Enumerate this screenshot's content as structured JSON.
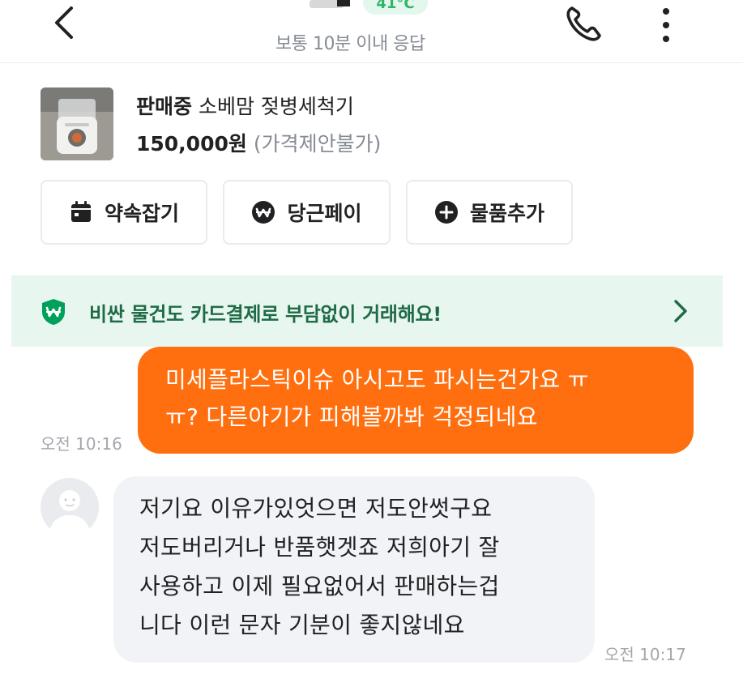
{
  "header": {
    "temperature": "41°C",
    "response_status": "보통 10분 이내 응답",
    "icons": [
      "back-arrow-icon",
      "phone-icon",
      "more-vertical-icon"
    ]
  },
  "product": {
    "status": "판매중",
    "title": "소베맘 젖병세척기",
    "price": "150,000원",
    "price_note": "(가격제안불가)"
  },
  "actions": [
    {
      "label": "약속잡기",
      "icon": "calendar-icon"
    },
    {
      "label": "당근페이",
      "icon": "won-pay-icon"
    },
    {
      "label": "물품추가",
      "icon": "plus-circle-icon"
    }
  ],
  "banner": {
    "text": "비싼 물건도 카드결제로 부담없이 거래해요!",
    "icon": "shield-won-icon"
  },
  "messages": [
    {
      "direction": "outgoing",
      "lines": [
        "미세플라스틱이슈 아시고도 파시는건가요 ㅠ",
        "ㅠ? 다른아기가 피해볼까봐 걱정되네요"
      ],
      "time": "오전 10:16"
    },
    {
      "direction": "incoming",
      "lines": [
        "저기요 이유가있엇으면 저도안썻구요",
        "저도버리거나 반품햇겟죠  저희아기 잘",
        "사용하고 이제 필요없어서 판매하는겁",
        "니다 이런 문자 기분이 좋지않네요"
      ],
      "time": "오전 10:17"
    }
  ],
  "colors": {
    "accent": "#ff6f0f",
    "banner_bg": "#e8f6f0",
    "banner_text": "#1f6b45",
    "temperature": "#2fb468",
    "incoming_bubble": "#f2f3f6"
  }
}
